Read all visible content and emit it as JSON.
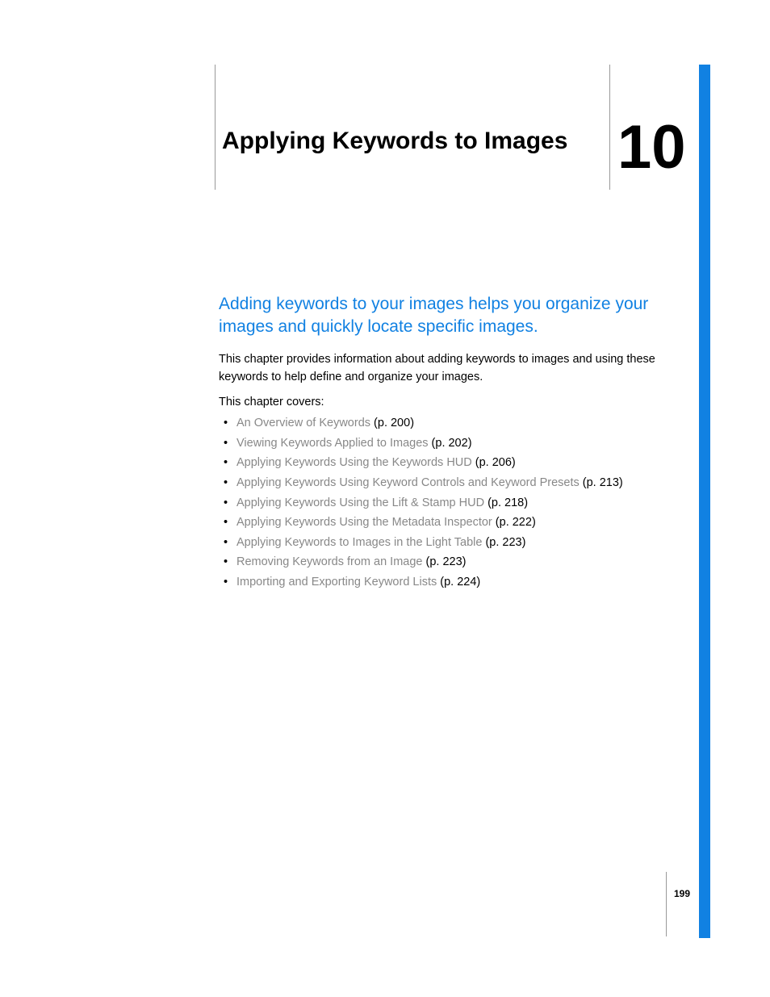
{
  "chapter": {
    "title": "Applying Keywords to Images",
    "number": "10"
  },
  "heading": "Adding keywords to your images helps you organize your images and quickly locate specific images.",
  "intro": "This chapter provides information about adding keywords to images and using these keywords to help define and organize your images.",
  "covers_label": "This chapter covers:",
  "toc": [
    {
      "title": "An Overview of Keywords",
      "page": "(p. 200)"
    },
    {
      "title": "Viewing Keywords Applied to Images",
      "page": "(p. 202)"
    },
    {
      "title": "Applying Keywords Using the Keywords HUD",
      "page": "(p. 206)"
    },
    {
      "title": "Applying Keywords Using Keyword Controls and Keyword Presets",
      "page": "(p. 213)"
    },
    {
      "title": "Applying Keywords Using the Lift & Stamp HUD",
      "page": "(p. 218)"
    },
    {
      "title": "Applying Keywords Using the Metadata Inspector",
      "page": "(p. 222)"
    },
    {
      "title": "Applying Keywords to Images in the Light Table",
      "page": "(p. 223)"
    },
    {
      "title": "Removing Keywords from an Image",
      "page": "(p. 223)"
    },
    {
      "title": "Importing and Exporting Keyword Lists",
      "page": "(p. 224)"
    }
  ],
  "page_number": "199"
}
